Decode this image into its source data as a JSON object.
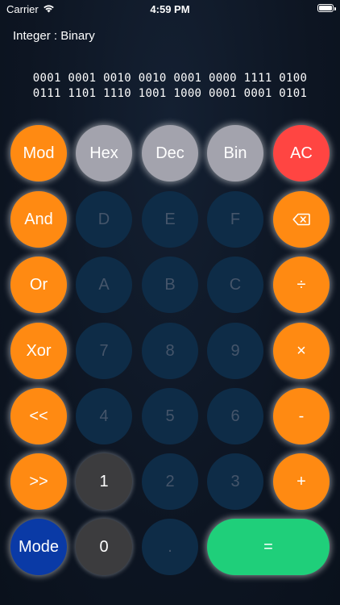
{
  "status_bar": {
    "carrier": "Carrier",
    "time": "4:59 PM",
    "wifi_icon": "wifi-icon",
    "battery_icon": "battery-icon"
  },
  "header": {
    "mode": "Integer : Binary"
  },
  "display": {
    "line1": "0001 0001 0010 0010 0001 0000 1111 0100",
    "line2": "0111 1101 1110 1001 1000 0001 0001 0101"
  },
  "keys": {
    "mod": "Mod",
    "hex": "Hex",
    "dec": "Dec",
    "bin": "Bin",
    "ac": "AC",
    "and": "And",
    "d": "D",
    "e": "E",
    "f": "F",
    "backspace_icon": "backspace-icon",
    "or": "Or",
    "a": "A",
    "b": "B",
    "c": "C",
    "divide": "÷",
    "xor": "Xor",
    "seven": "7",
    "eight": "8",
    "nine": "9",
    "multiply": "×",
    "shift_left": "<<",
    "four": "4",
    "five": "5",
    "six": "6",
    "minus": "-",
    "shift_right": ">>",
    "one": "1",
    "two": "2",
    "three": "3",
    "plus": "+",
    "mode": "Mode",
    "zero": "0",
    "dot": ".",
    "equals": "="
  },
  "colors": {
    "operator": "#ff8a12",
    "base": "#a3a3ad",
    "clear": "#ff4542",
    "disabled_key": "#0e2c47",
    "enabled_digit": "#3c3c3e",
    "mode": "#0a3aa6",
    "equals": "#1fcf7a"
  }
}
